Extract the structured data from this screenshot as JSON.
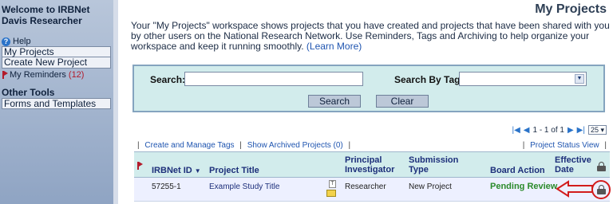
{
  "sidebar": {
    "welcome": "Welcome to IRBNet Davis Researcher",
    "help": "Help",
    "items": [
      {
        "label": "My Projects"
      },
      {
        "label": "Create New Project"
      }
    ],
    "reminders_label": "My Reminders",
    "reminders_count": "(12)",
    "other_tools": "Other Tools",
    "forms_templates": "Forms and Templates"
  },
  "main": {
    "title": "My Projects",
    "intro": "Your \"My Projects\" workspace shows projects that you have created and projects that have been shared with you by other users on the National Research Network. Use Reminders, Tags and Archiving to help organize your workspace and keep it running smoothly.",
    "learn_more": "(Learn More)"
  },
  "search": {
    "label": "Search:",
    "value": "",
    "tag_label": "Search By Tag:",
    "tag_value": "",
    "search_button": "Search",
    "clear_button": "Clear"
  },
  "pager": {
    "range": "1 - 1 of 1",
    "page_size": "25"
  },
  "links": {
    "create_tags": "Create and Manage Tags",
    "show_archived": "Show Archived Projects (0)",
    "status_view": "Project Status View"
  },
  "table": {
    "headers": {
      "irbnet_id": "IRBNet ID",
      "project_title": "Project Title",
      "pi": "Principal Investigator",
      "submission_type": "Submission Type",
      "board_action": "Board Action",
      "effective_date": "Effective Date"
    },
    "rows": [
      {
        "id": "57255-1",
        "title": "Example Study Title",
        "pi": "Researcher",
        "submission_type": "New Project",
        "board_action": "Pending Review",
        "effective_date": ""
      }
    ]
  },
  "colors": {
    "accent": "#1d2f7a",
    "pending": "#2a8a2a",
    "annotation": "#d21c1c"
  },
  "icons": [
    "help-icon",
    "reminder-flag-icon",
    "first-page-icon",
    "prev-page-icon",
    "next-page-icon",
    "last-page-icon",
    "lock-icon",
    "document-icon",
    "note-icon"
  ]
}
